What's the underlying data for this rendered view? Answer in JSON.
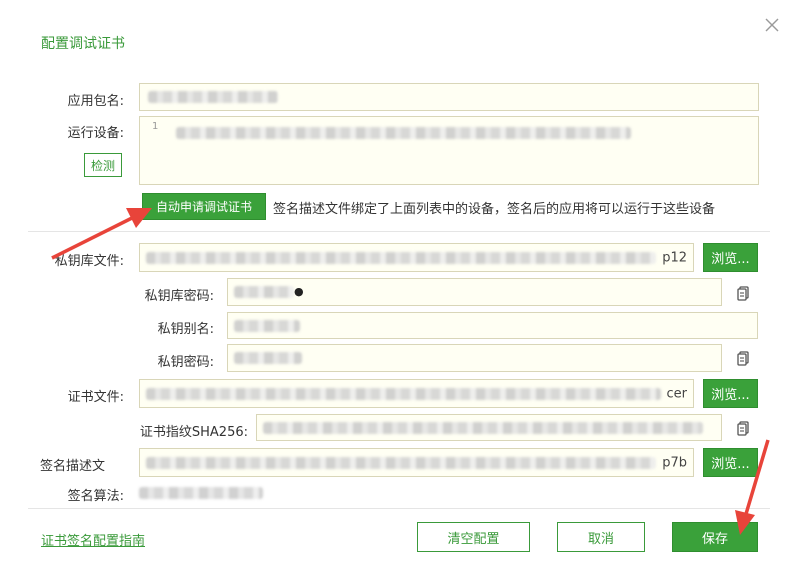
{
  "dialog": {
    "title": "配置调试证书",
    "close_icon": "close-icon"
  },
  "labels": {
    "package_name": "应用包名:",
    "device": "运行设备:",
    "keystore_file": "私钥库文件:",
    "keystore_password": "私钥库密码:",
    "key_alias": "私钥别名:",
    "key_password": "私钥密码:",
    "cert_file": "证书文件:",
    "cert_fingerprint": "证书指纹SHA256:",
    "profile_file": "签名描述文",
    "sign_algorithm": "签名算法:"
  },
  "fields": {
    "device_line_number": "1",
    "keystore_suffix": "p12",
    "keystore_password_dot": "●",
    "cert_suffix": "cer",
    "profile_suffix": "p7b"
  },
  "buttons": {
    "detect": "检测",
    "auto_apply": "自动申请调试证书",
    "browse": "浏览...",
    "clear": "清空配置",
    "cancel": "取消",
    "save": "保存"
  },
  "hint_text": "签名描述文件绑定了上面列表中的设备，签名后的应用将可以运行于这些设备",
  "guide_link": "证书签名配置指南",
  "colors": {
    "accent": "#3aa13a",
    "annotation_arrow": "#e8443a"
  }
}
